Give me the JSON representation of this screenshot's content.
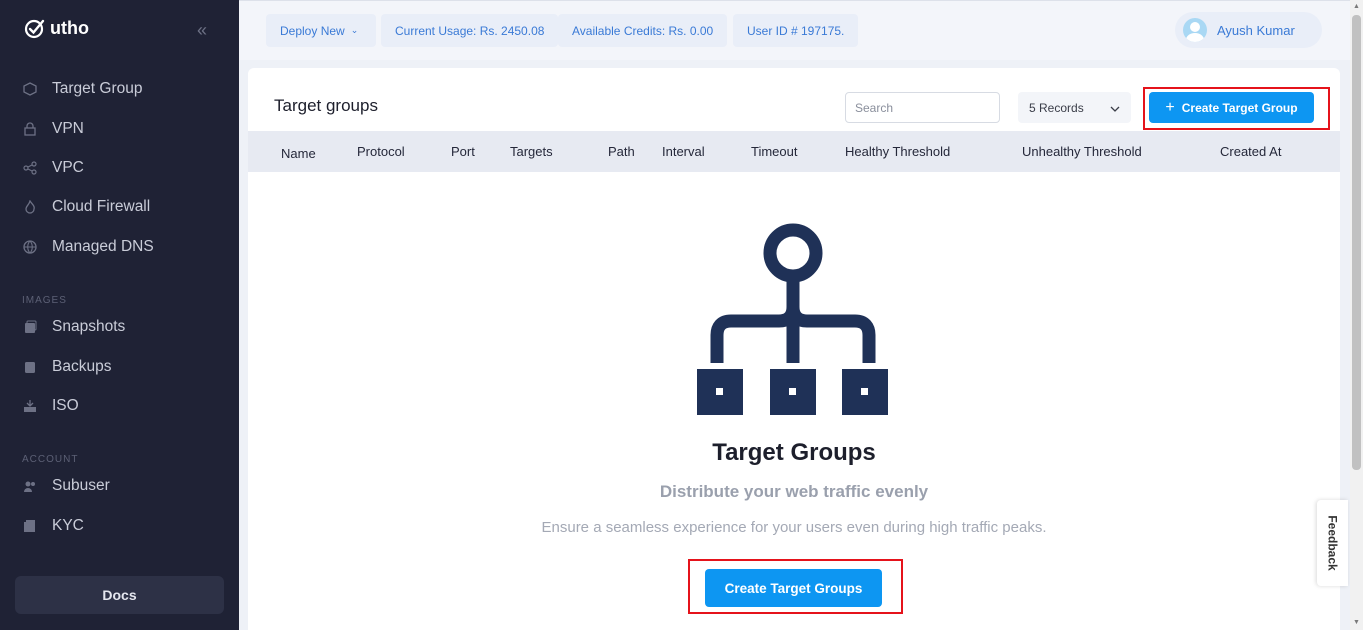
{
  "sidebar": {
    "brand": "utho",
    "items": [
      {
        "label": "Target Group"
      },
      {
        "label": "VPN"
      },
      {
        "label": "VPC"
      },
      {
        "label": "Cloud Firewall"
      },
      {
        "label": "Managed DNS"
      },
      {
        "label": "Snapshots"
      },
      {
        "label": "Backups"
      },
      {
        "label": "ISO"
      },
      {
        "label": "Subuser"
      },
      {
        "label": "KYC"
      }
    ],
    "sections": {
      "images": "IMAGES",
      "account": "ACCOUNT"
    },
    "docs": "Docs"
  },
  "topbar": {
    "deploy": "Deploy New",
    "usage": "Current Usage: Rs. 2450.08",
    "credits": "Available Credits: Rs. 0.00",
    "user_id": "User ID # 197175.",
    "user_name": "Ayush Kumar"
  },
  "main": {
    "title": "Target groups",
    "search_placeholder": "Search",
    "records": "5 Records",
    "create_button": "Create Target Group",
    "columns": [
      "Name",
      "Protocol",
      "Port",
      "Targets",
      "Path",
      "Interval",
      "Timeout",
      "Healthy Threshold",
      "Unhealthy Threshold",
      "Created At"
    ],
    "empty": {
      "title": "Target Groups",
      "subtitle": "Distribute your web traffic evenly",
      "description": "Ensure a seamless experience for your users even during high traffic peaks.",
      "button": "Create Target Groups"
    }
  },
  "feedback": "Feedback",
  "colors": {
    "sidebar_bg": "#1f2235",
    "accent": "#0d96f2",
    "highlight": "#e5131b",
    "illustration": "#1f3157"
  }
}
